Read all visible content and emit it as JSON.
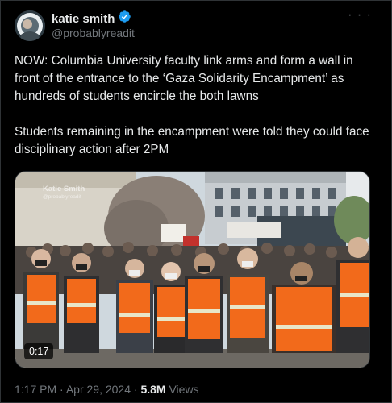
{
  "author": {
    "name": "katie smith",
    "handle": "@probablyreadit",
    "verified_color": "#1d9bf0"
  },
  "tweet": {
    "text": "NOW: Columbia University faculty link arms and form a wall in front of the entrance to the ‘Gaza Solidarity Encampment’ as hundreds of students encircle the both lawns\n\nStudents remaining in the encampment were told they could face disciplinary action after 2PM",
    "more_icon": "more-icon",
    "time": "1:17 PM",
    "date": "Apr 29, 2024",
    "separator": "·",
    "views_count": "5.8M",
    "views_label": "Views"
  },
  "video": {
    "duration": "0:17",
    "watermark_name": "Katie Smith",
    "watermark_handle": "@probablyreadit"
  },
  "colors": {
    "background": "#000000",
    "text": "#e7e9ea",
    "muted": "#71767b",
    "vest_orange": "#f26a1b",
    "vest_stripe": "#e8e6c8"
  }
}
